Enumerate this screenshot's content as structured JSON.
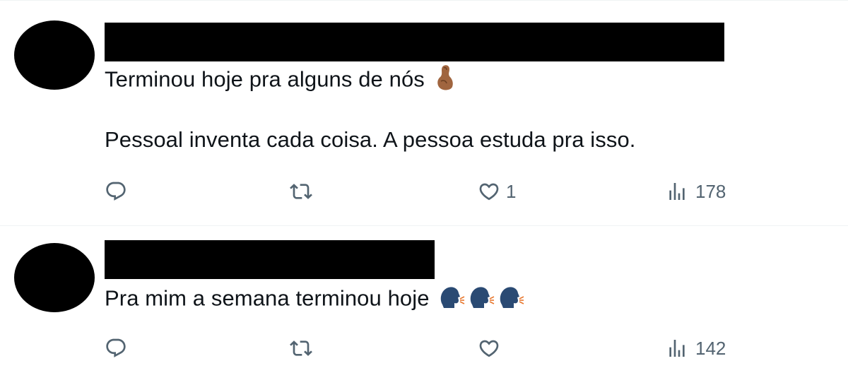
{
  "tweets": [
    {
      "lines": [
        "Terminou hoje pra alguns de nós",
        "Pessoal inventa cada coisa. A pessoa estuda pra isso."
      ],
      "emoji": [
        "pinched-fingers"
      ],
      "actions": {
        "reply": "",
        "retweet": "",
        "like": "1",
        "views": "178"
      }
    },
    {
      "lines": [
        "Pra mim a semana terminou hoje"
      ],
      "emoji": [
        "speaking-head",
        "speaking-head",
        "speaking-head"
      ],
      "actions": {
        "reply": "",
        "retweet": "",
        "like": "",
        "views": "142"
      }
    }
  ],
  "colors": {
    "icon": "#536471",
    "text": "#0f1419",
    "divider": "#eff3f4"
  }
}
